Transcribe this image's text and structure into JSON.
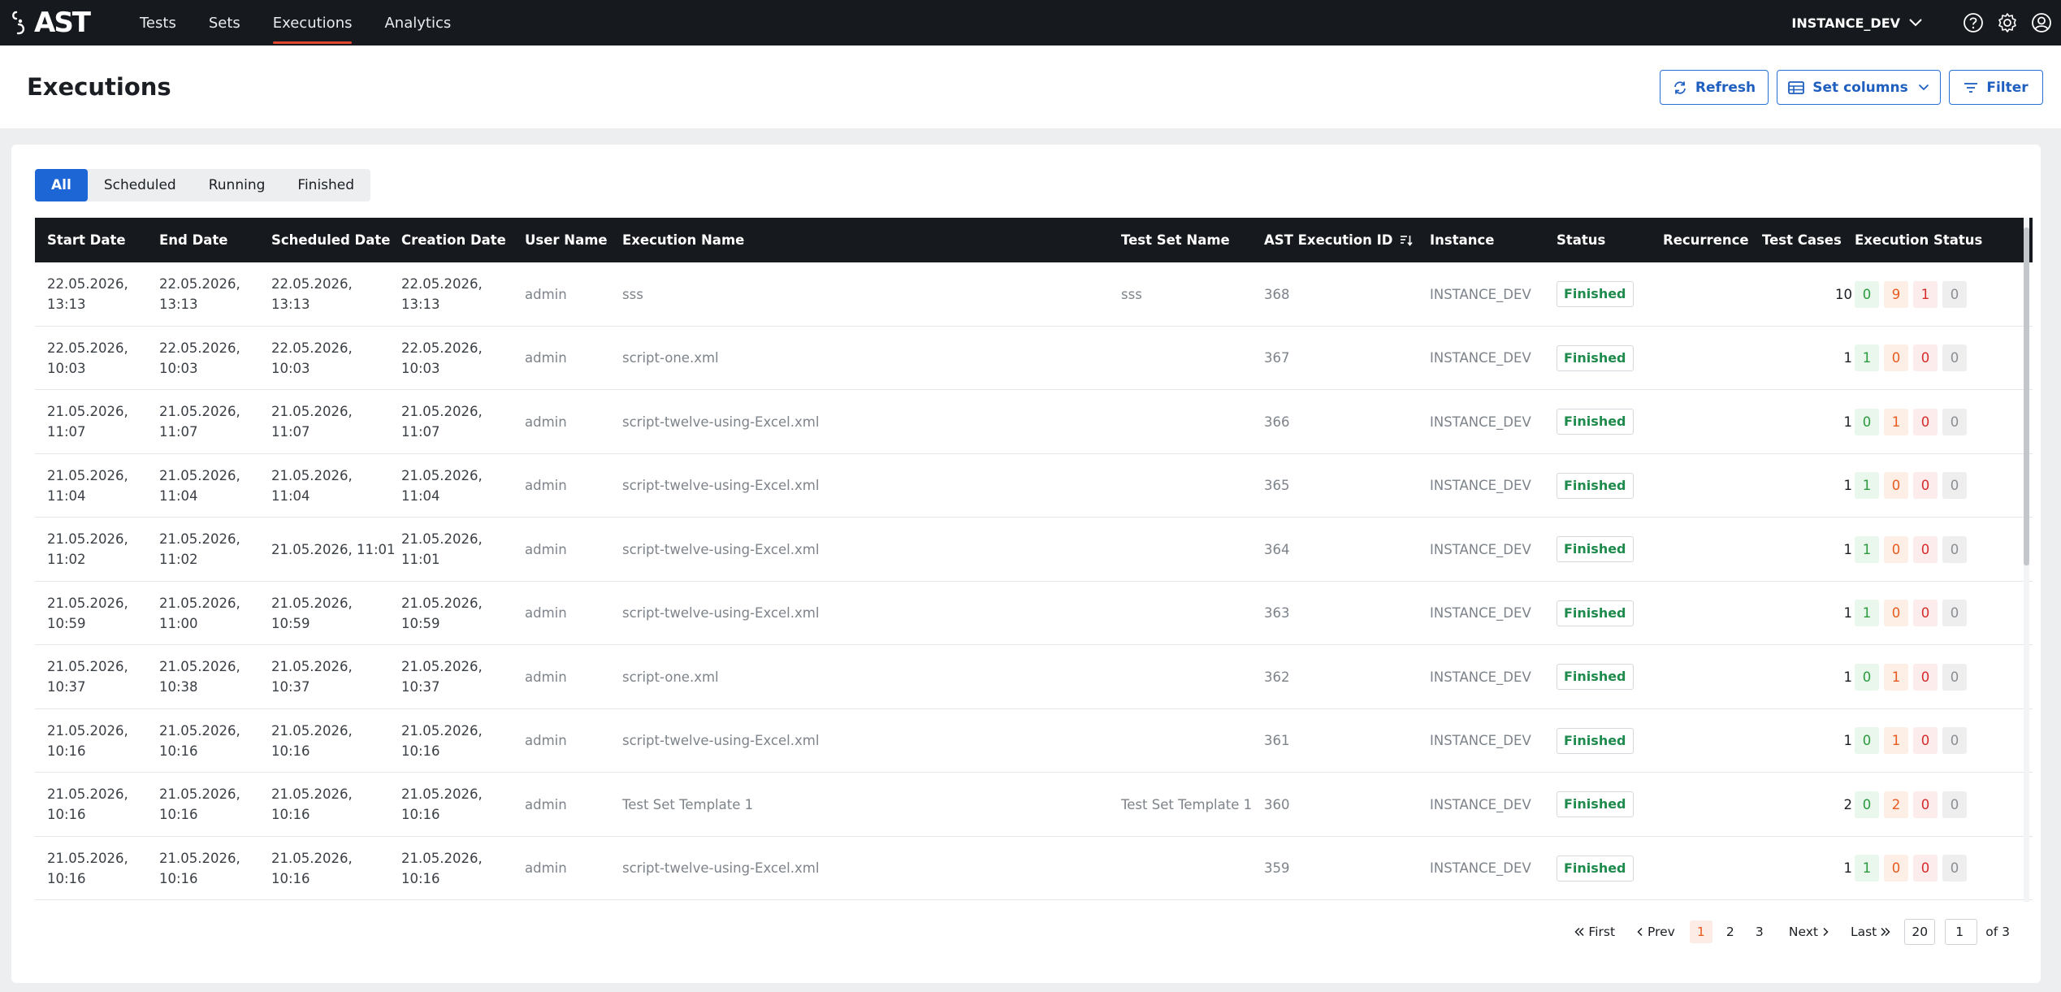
{
  "app": {
    "logo_text": "AST",
    "nav": [
      {
        "label": "Tests",
        "active": false
      },
      {
        "label": "Sets",
        "active": false
      },
      {
        "label": "Executions",
        "active": true
      },
      {
        "label": "Analytics",
        "active": false
      }
    ],
    "instance": "INSTANCE_DEV",
    "icons": [
      "help-icon",
      "settings-icon",
      "user-icon"
    ]
  },
  "header": {
    "title": "Executions",
    "refresh_label": "Refresh",
    "columns_label": "Set columns",
    "filter_label": "Filter"
  },
  "tabs": [
    {
      "label": "All",
      "active": true
    },
    {
      "label": "Scheduled",
      "active": false
    },
    {
      "label": "Running",
      "active": false
    },
    {
      "label": "Finished",
      "active": false
    }
  ],
  "columns": [
    "Start Date",
    "End Date",
    "Scheduled Date",
    "Creation Date",
    "User Name",
    "Execution Name",
    "Test Set Name",
    "AST Execution ID",
    "Instance",
    "Status",
    "Recurrence",
    "Test Cases",
    "Execution Status"
  ],
  "rows": [
    {
      "start": [
        "22.05.2026,",
        "13:13"
      ],
      "end": [
        "22.05.2026,",
        "13:13"
      ],
      "scheduled": [
        "22.05.2026,",
        "13:13"
      ],
      "creation": [
        "22.05.2026,",
        "13:13"
      ],
      "user": "admin",
      "name": "sss",
      "set": "sss",
      "id": "368",
      "instance": "INSTANCE_DEV",
      "status": "Finished",
      "recurrence": "",
      "cases": "10",
      "exec": [
        "0",
        "9",
        "1",
        "0"
      ]
    },
    {
      "start": [
        "22.05.2026,",
        "10:03"
      ],
      "end": [
        "22.05.2026,",
        "10:03"
      ],
      "scheduled": [
        "22.05.2026,",
        "10:03"
      ],
      "creation": [
        "22.05.2026,",
        "10:03"
      ],
      "user": "admin",
      "name": "script-one.xml",
      "set": "",
      "id": "367",
      "instance": "INSTANCE_DEV",
      "status": "Finished",
      "recurrence": "",
      "cases": "1",
      "exec": [
        "1",
        "0",
        "0",
        "0"
      ]
    },
    {
      "start": [
        "21.05.2026,",
        "11:07"
      ],
      "end": [
        "21.05.2026,",
        "11:07"
      ],
      "scheduled": [
        "21.05.2026,",
        "11:07"
      ],
      "creation": [
        "21.05.2026,",
        "11:07"
      ],
      "user": "admin",
      "name": "script-twelve-using-Excel.xml",
      "set": "",
      "id": "366",
      "instance": "INSTANCE_DEV",
      "status": "Finished",
      "recurrence": "",
      "cases": "1",
      "exec": [
        "0",
        "1",
        "0",
        "0"
      ]
    },
    {
      "start": [
        "21.05.2026,",
        "11:04"
      ],
      "end": [
        "21.05.2026,",
        "11:04"
      ],
      "scheduled": [
        "21.05.2026,",
        "11:04"
      ],
      "creation": [
        "21.05.2026,",
        "11:04"
      ],
      "user": "admin",
      "name": "script-twelve-using-Excel.xml",
      "set": "",
      "id": "365",
      "instance": "INSTANCE_DEV",
      "status": "Finished",
      "recurrence": "",
      "cases": "1",
      "exec": [
        "1",
        "0",
        "0",
        "0"
      ]
    },
    {
      "start": [
        "21.05.2026,",
        "11:02"
      ],
      "end": [
        "21.05.2026,",
        "11:02"
      ],
      "scheduled": [
        "21.05.2026, 11:01",
        ""
      ],
      "creation": [
        "21.05.2026,",
        "11:01"
      ],
      "user": "admin",
      "name": "script-twelve-using-Excel.xml",
      "set": "",
      "id": "364",
      "instance": "INSTANCE_DEV",
      "status": "Finished",
      "recurrence": "",
      "cases": "1",
      "exec": [
        "1",
        "0",
        "0",
        "0"
      ]
    },
    {
      "start": [
        "21.05.2026,",
        "10:59"
      ],
      "end": [
        "21.05.2026,",
        "11:00"
      ],
      "scheduled": [
        "21.05.2026,",
        "10:59"
      ],
      "creation": [
        "21.05.2026,",
        "10:59"
      ],
      "user": "admin",
      "name": "script-twelve-using-Excel.xml",
      "set": "",
      "id": "363",
      "instance": "INSTANCE_DEV",
      "status": "Finished",
      "recurrence": "",
      "cases": "1",
      "exec": [
        "1",
        "0",
        "0",
        "0"
      ]
    },
    {
      "start": [
        "21.05.2026,",
        "10:37"
      ],
      "end": [
        "21.05.2026,",
        "10:38"
      ],
      "scheduled": [
        "21.05.2026,",
        "10:37"
      ],
      "creation": [
        "21.05.2026,",
        "10:37"
      ],
      "user": "admin",
      "name": "script-one.xml",
      "set": "",
      "id": "362",
      "instance": "INSTANCE_DEV",
      "status": "Finished",
      "recurrence": "",
      "cases": "1",
      "exec": [
        "0",
        "1",
        "0",
        "0"
      ]
    },
    {
      "start": [
        "21.05.2026,",
        "10:16"
      ],
      "end": [
        "21.05.2026,",
        "10:16"
      ],
      "scheduled": [
        "21.05.2026,",
        "10:16"
      ],
      "creation": [
        "21.05.2026,",
        "10:16"
      ],
      "user": "admin",
      "name": "script-twelve-using-Excel.xml",
      "set": "",
      "id": "361",
      "instance": "INSTANCE_DEV",
      "status": "Finished",
      "recurrence": "",
      "cases": "1",
      "exec": [
        "0",
        "1",
        "0",
        "0"
      ]
    },
    {
      "start": [
        "21.05.2026,",
        "10:16"
      ],
      "end": [
        "21.05.2026,",
        "10:16"
      ],
      "scheduled": [
        "21.05.2026,",
        "10:16"
      ],
      "creation": [
        "21.05.2026,",
        "10:16"
      ],
      "user": "admin",
      "name": "Test Set Template 1",
      "set": "Test Set Template 1",
      "id": "360",
      "instance": "INSTANCE_DEV",
      "status": "Finished",
      "recurrence": "",
      "cases": "2",
      "exec": [
        "0",
        "2",
        "0",
        "0"
      ]
    },
    {
      "start": [
        "21.05.2026,",
        "10:16"
      ],
      "end": [
        "21.05.2026,",
        "10:16"
      ],
      "scheduled": [
        "21.05.2026,",
        "10:16"
      ],
      "creation": [
        "21.05.2026,",
        "10:16"
      ],
      "user": "admin",
      "name": "script-twelve-using-Excel.xml",
      "set": "",
      "id": "359",
      "instance": "INSTANCE_DEV",
      "status": "Finished",
      "recurrence": "",
      "cases": "1",
      "exec": [
        "1",
        "0",
        "0",
        "0"
      ]
    }
  ],
  "pagination": {
    "first": "First",
    "prev": "Prev",
    "pages": [
      "1",
      "2",
      "3"
    ],
    "current": "1",
    "next": "Next",
    "last": "Last",
    "page_size": "20",
    "page_input": "1",
    "of_label": "of 3"
  },
  "colors": {
    "topbar": "#16191d",
    "accent": "#1c66d6",
    "nav_underline": "#e3462f",
    "status_green": "#1e8a4c"
  }
}
